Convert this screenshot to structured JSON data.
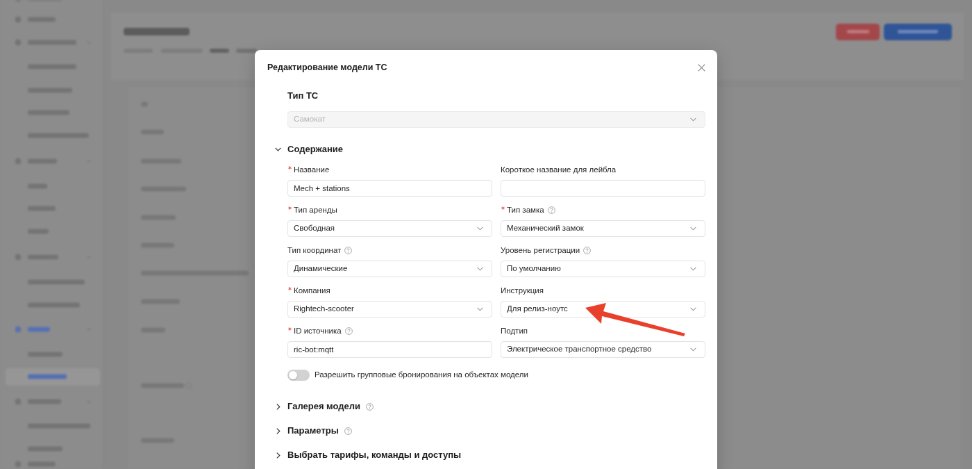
{
  "modal": {
    "title": "Редактирование модели ТС"
  },
  "vehicle_type": {
    "label": "Тип ТС",
    "value": "Самокат",
    "disabled": true
  },
  "sections": [
    {
      "title": "Содержание",
      "expanded": true,
      "help": false,
      "fields": [
        {
          "label": "Название",
          "required": true,
          "help": false,
          "kind": "text",
          "value": "Mech + stations",
          "annotated": false
        },
        {
          "label": "Короткое название для лейбла",
          "required": false,
          "help": false,
          "kind": "text",
          "annotated": false
        },
        {
          "label": "Тип аренды",
          "required": true,
          "help": false,
          "kind": "select",
          "value": "Свободная",
          "annotated": false
        },
        {
          "label": "Тип замка",
          "required": true,
          "help": true,
          "kind": "select",
          "value": "Механический замок",
          "annotated": false
        },
        {
          "label": "Тип координат",
          "required": false,
          "help": true,
          "kind": "select",
          "value": "Динамические",
          "annotated": false
        },
        {
          "label": "Уровень регистрации",
          "required": false,
          "help": true,
          "kind": "select",
          "value": "По умолчанию",
          "annotated": false
        },
        {
          "label": "Компания",
          "required": true,
          "help": false,
          "kind": "select",
          "value": "Rightech-scooter",
          "annotated": false
        },
        {
          "label": "Инструкция",
          "required": false,
          "help": false,
          "kind": "select",
          "value": "Для релиз-ноутс",
          "annotated": true
        },
        {
          "label": "ID источника",
          "required": true,
          "help": true,
          "kind": "text",
          "value": "ric-bot:mqtt",
          "annotated": false
        },
        {
          "label": "Подтип",
          "required": false,
          "help": false,
          "kind": "select",
          "value": "Электрическое транспортное средство",
          "annotated": false
        }
      ],
      "toggle": {
        "label": "Разрешить групповые бронирования на объектах модели",
        "on": false
      }
    },
    {
      "title": "Галерея модели",
      "expanded": false,
      "help": true
    },
    {
      "title": "Параметры",
      "expanded": false,
      "help": true
    },
    {
      "title": "Выбрать тарифы, команды и доступы",
      "expanded": false,
      "help": false
    }
  ]
}
